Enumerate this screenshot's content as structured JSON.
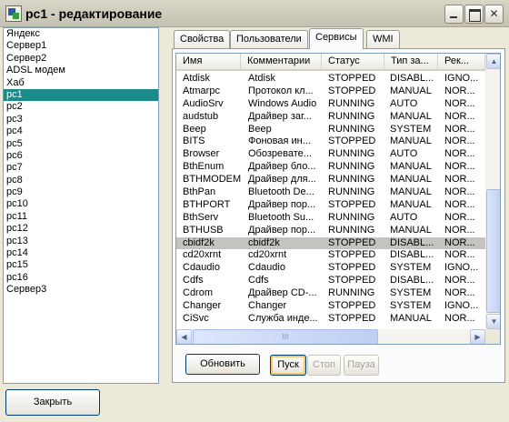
{
  "window": {
    "title": "pc1 - редактирование",
    "icons": {
      "app": "app-icon",
      "minimize": "minimize-icon",
      "maximize": "maximize-icon",
      "close": "close-icon"
    },
    "close_glyph": "✕"
  },
  "hosts": {
    "selected_index": 4,
    "items": [
      "Яндекс",
      "Сервер1",
      "Сервер2",
      "ADSL модем",
      "Хаб",
      "pc1",
      "pc2",
      "pc3",
      "pc4",
      "pc5",
      "pc6",
      "pc7",
      "pc8",
      "pc9",
      "pc10",
      "pc11",
      "pc12",
      "pc13",
      "pc14",
      "pc15",
      "pc16",
      "Сервер3"
    ]
  },
  "tabs": [
    {
      "label": "Свойства",
      "active": false
    },
    {
      "label": "Пользователи",
      "active": false
    },
    {
      "label": "Сервисы",
      "active": true
    },
    {
      "label": "WMI",
      "active": false
    }
  ],
  "services": {
    "columns": [
      "Имя",
      "Комментарии",
      "Статус",
      "Тип за...",
      "Рек..."
    ],
    "selected_index": 13,
    "rows": [
      [
        "Atdisk",
        "Atdisk",
        "STOPPED",
        "DISABL...",
        "IGNO..."
      ],
      [
        "Atmarpc",
        "Протокол кл...",
        "STOPPED",
        "MANUAL",
        "NOR..."
      ],
      [
        "AudioSrv",
        "Windows Audio",
        "RUNNING",
        "AUTO",
        "NOR..."
      ],
      [
        "audstub",
        "Драйвер заг...",
        "RUNNING",
        "MANUAL",
        "NOR..."
      ],
      [
        "Beep",
        "Beep",
        "RUNNING",
        "SYSTEM",
        "NOR..."
      ],
      [
        "BITS",
        "Фоновая ин...",
        "STOPPED",
        "MANUAL",
        "NOR..."
      ],
      [
        "Browser",
        "Обозревате...",
        "RUNNING",
        "AUTO",
        "NOR..."
      ],
      [
        "BthEnum",
        "Драйвер бло...",
        "RUNNING",
        "MANUAL",
        "NOR..."
      ],
      [
        "BTHMODEM",
        "Драйвер для...",
        "RUNNING",
        "MANUAL",
        "NOR..."
      ],
      [
        "BthPan",
        "Bluetooth De...",
        "RUNNING",
        "MANUAL",
        "NOR..."
      ],
      [
        "BTHPORT",
        "Драйвер пор...",
        "STOPPED",
        "MANUAL",
        "NOR..."
      ],
      [
        "BthServ",
        "Bluetooth Su...",
        "RUNNING",
        "AUTO",
        "NOR..."
      ],
      [
        "BTHUSB",
        "Драйвер пор...",
        "RUNNING",
        "MANUAL",
        "NOR..."
      ],
      [
        "cbidf2k",
        "cbidf2k",
        "STOPPED",
        "DISABL...",
        "NOR..."
      ],
      [
        "cd20xrnt",
        "cd20xrnt",
        "STOPPED",
        "DISABL...",
        "NOR..."
      ],
      [
        "Cdaudio",
        "Cdaudio",
        "STOPPED",
        "SYSTEM",
        "IGNO..."
      ],
      [
        "Cdfs",
        "Cdfs",
        "STOPPED",
        "DISABL...",
        "NOR..."
      ],
      [
        "Cdrom",
        "Драйвер CD-...",
        "RUNNING",
        "SYSTEM",
        "NOR..."
      ],
      [
        "Changer",
        "Changer",
        "STOPPED",
        "SYSTEM",
        "IGNO..."
      ],
      [
        "CiSvc",
        "Служба инде...",
        "STOPPED",
        "MANUAL",
        "NOR..."
      ]
    ],
    "scroll": {
      "up": "▲",
      "down": "▼",
      "left": "◀",
      "right": "▶",
      "grip": "III"
    }
  },
  "actions": {
    "refresh": "Обновить",
    "start": "Пуск",
    "stop": "Стоп",
    "pause": "Пауза",
    "close": "Закрыть"
  }
}
